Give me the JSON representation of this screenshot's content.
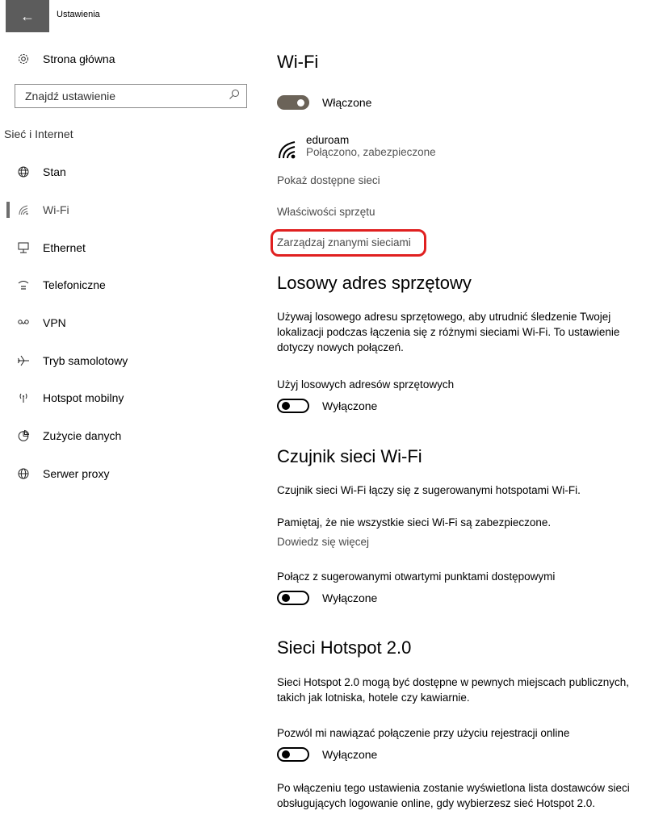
{
  "window": {
    "title": "Ustawienia",
    "back_glyph": "←"
  },
  "sidebar": {
    "home_label": "Strona główna",
    "search_placeholder": "Znajdź ustawienie",
    "section_label": "Sieć i Internet",
    "items": [
      {
        "label": "Stan",
        "icon": "globe-icon"
      },
      {
        "label": "Wi-Fi",
        "icon": "wifi-icon",
        "active": true
      },
      {
        "label": "Ethernet",
        "icon": "ethernet-icon"
      },
      {
        "label": "Telefoniczne",
        "icon": "dialup-icon"
      },
      {
        "label": "VPN",
        "icon": "vpn-icon"
      },
      {
        "label": "Tryb samolotowy",
        "icon": "airplane-icon"
      },
      {
        "label": "Hotspot mobilny",
        "icon": "hotspot-icon"
      },
      {
        "label": "Zużycie danych",
        "icon": "data-usage-icon"
      },
      {
        "label": "Serwer proxy",
        "icon": "proxy-icon"
      }
    ]
  },
  "main": {
    "wifi_title": "Wi-Fi",
    "wifi_toggle_label": "Włączone",
    "network": {
      "name": "eduroam",
      "status": "Połączono, zabezpieczone"
    },
    "links": {
      "show_networks": "Pokaż dostępne sieci",
      "hardware_props": "Właściwości sprzętu",
      "manage_known": "Zarządzaj znanymi sieciami"
    },
    "random_hw": {
      "title": "Losowy adres sprzętowy",
      "desc": "Używaj losowego adresu sprzętowego, aby utrudnić śledzenie Twojej lokalizacji podczas łączenia się z różnymi sieciami Wi-Fi. To ustawienie dotyczy nowych połączeń.",
      "option": "Użyj losowych adresów sprzętowych",
      "toggle_label": "Wyłączone"
    },
    "sense": {
      "title": "Czujnik sieci Wi-Fi",
      "desc1": "Czujnik sieci Wi-Fi łączy się z sugerowanymi hotspotami Wi-Fi.",
      "desc2": "Pamiętaj, że nie wszystkie sieci Wi-Fi są zabezpieczone.",
      "learn_more": "Dowiedz się więcej",
      "option": "Połącz z sugerowanymi otwartymi punktami dostępowymi",
      "toggle_label": "Wyłączone"
    },
    "hotspot20": {
      "title": "Sieci Hotspot 2.0",
      "desc": "Sieci Hotspot 2.0 mogą być dostępne w pewnych miejscach publicznych, takich jak lotniska, hotele czy kawiarnie.",
      "option": "Pozwól mi nawiązać połączenie przy użyciu rejestracji online",
      "toggle_label": "Wyłączone",
      "footer": "Po włączeniu tego ustawienia zostanie wyświetlona lista dostawców sieci obsługujących logowanie online, gdy wybierzesz sieć Hotspot 2.0."
    }
  },
  "colors": {
    "highlight": "#e02020",
    "toggle_on": "#6b6358",
    "back_button": "#5c5c5c"
  }
}
